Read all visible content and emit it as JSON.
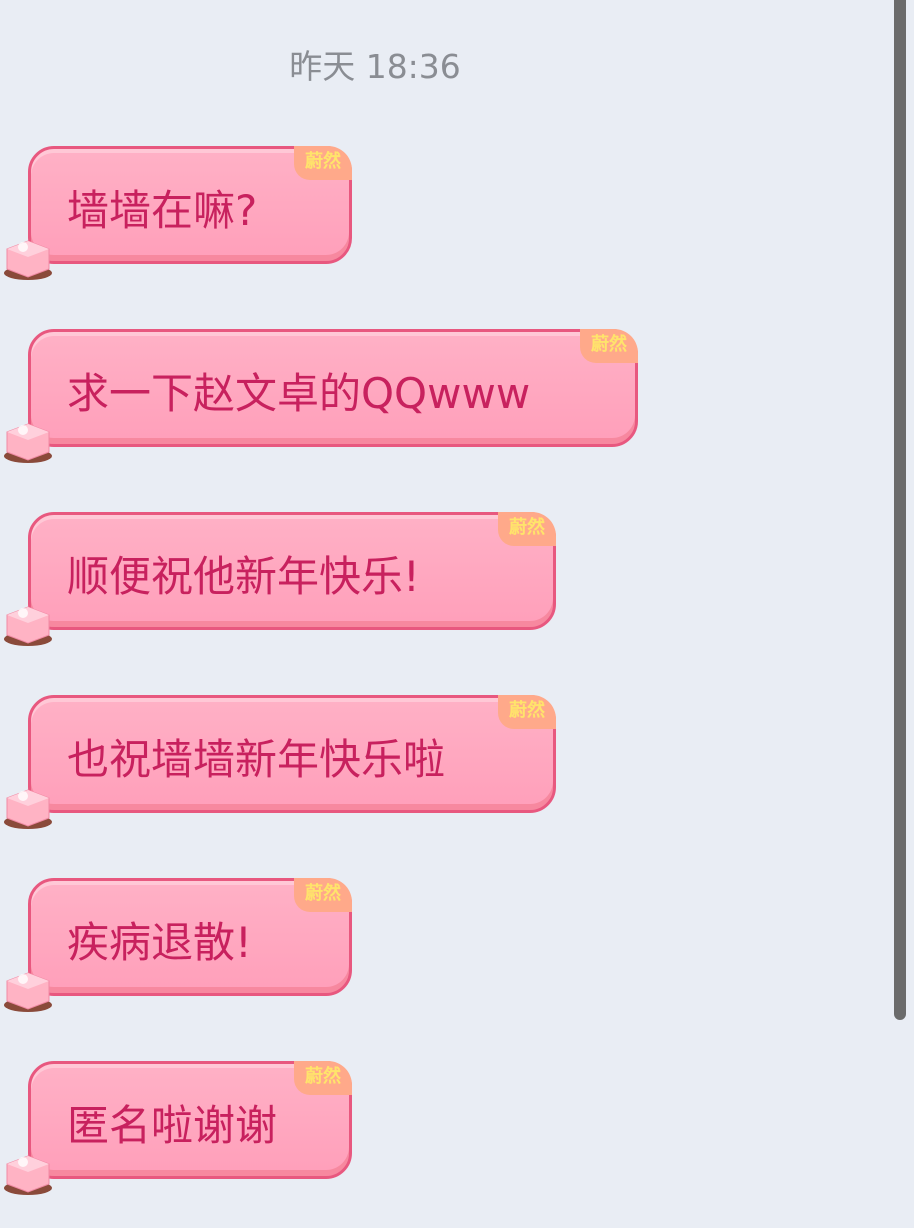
{
  "timestamp": "昨天 18:36",
  "messages": [
    {
      "text": "墙墙在嘛?",
      "tag": "蔚然"
    },
    {
      "text": "求一下赵文卓的QQwww",
      "tag": "蔚然"
    },
    {
      "text": "顺便祝他新年快乐!",
      "tag": "蔚然"
    },
    {
      "text": "也祝墙墙新年快乐啦",
      "tag": "蔚然"
    },
    {
      "text": "疾病退散!",
      "tag": "蔚然"
    },
    {
      "text": "匿名啦谢谢",
      "tag": "蔚然"
    }
  ],
  "colors": {
    "bubble": "#ffa8bf",
    "text": "#c8215e",
    "background": "#e9edf4"
  }
}
